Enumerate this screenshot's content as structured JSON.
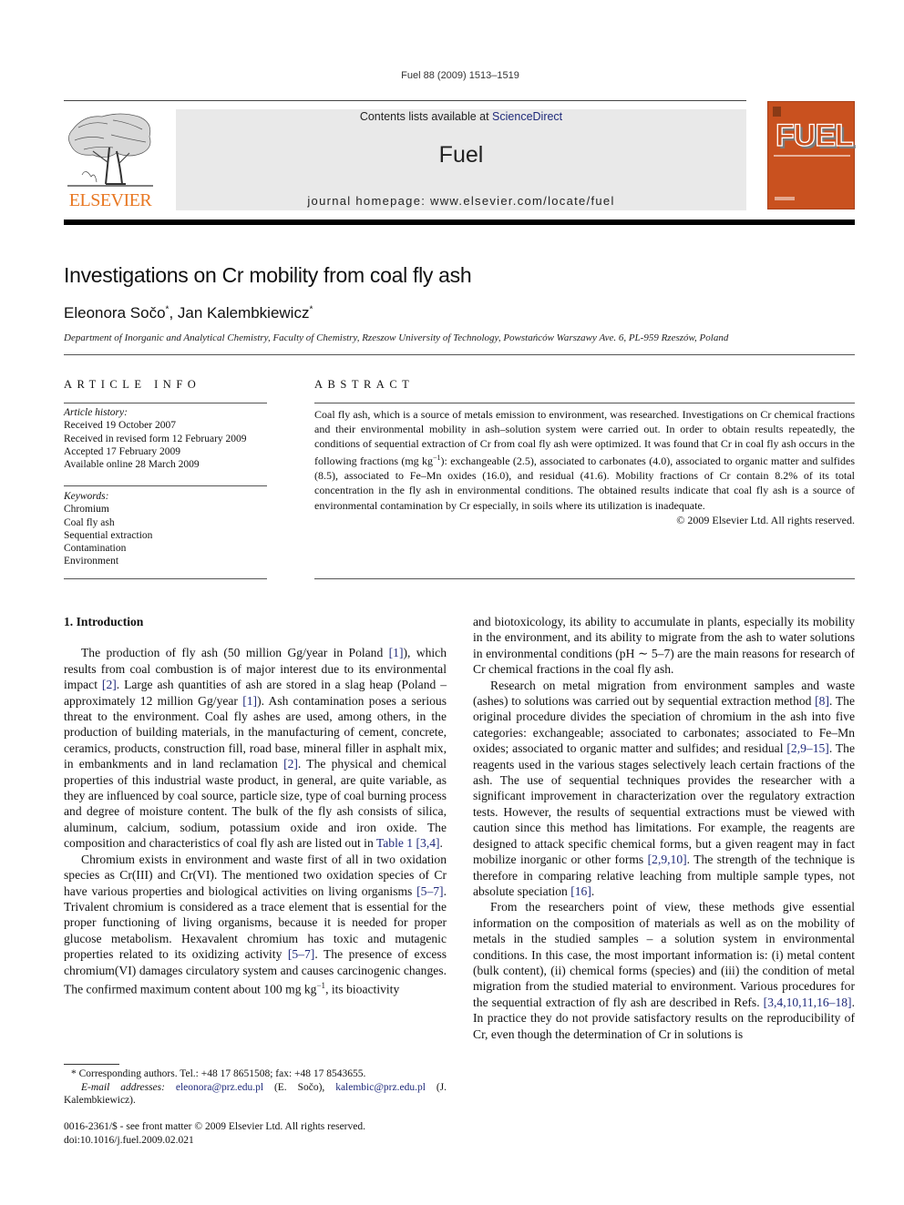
{
  "running_head": "Fuel 88 (2009) 1513–1519",
  "masthead": {
    "contents_prefix": "Contents lists available at ",
    "contents_link": "ScienceDirect",
    "journal_name": "Fuel",
    "homepage": "journal homepage: www.elsevier.com/locate/fuel"
  },
  "publisher_logo": {
    "wordmark": "ELSEVIER",
    "color": "#e87722"
  },
  "cover": {
    "title": "FUEL",
    "color": "#c9511f"
  },
  "article": {
    "title": "Investigations on Cr mobility from coal fly ash",
    "authors": [
      {
        "name": "Eleonora Sočo",
        "mark": "*"
      },
      {
        "name": "Jan Kalembkiewicz",
        "mark": "*"
      }
    ],
    "author_separator": ", ",
    "affiliation": "Department of Inorganic and Analytical Chemistry, Faculty of Chemistry, Rzeszow University of Technology, Powstańców Warszawy Ave. 6, PL-959 Rzeszów, Poland"
  },
  "article_info": {
    "heading": "ARTICLE INFO",
    "history_label": "Article history:",
    "history": [
      "Received 19 October 2007",
      "Received in revised form 12 February 2009",
      "Accepted 17 February 2009",
      "Available online 28 March 2009"
    ],
    "keywords_label": "Keywords:",
    "keywords": [
      "Chromium",
      "Coal fly ash",
      "Sequential extraction",
      "Contamination",
      "Environment"
    ]
  },
  "abstract": {
    "heading": "ABSTRACT",
    "text_1": "Coal fly ash, which is a source of metals emission to environment, was researched. Investigations on Cr chemical fractions and their environmental mobility in ash–solution system were carried out. In order to obtain results repeatedly, the conditions of sequential extraction of Cr from coal fly ash were optimized. It was found that Cr in coal fly ash occurs in the following fractions (mg kg",
    "unit_sup": "−1",
    "text_2": "): exchangeable (2.5), associated to carbonates (4.0), associated to organic matter and sulfides (8.5), associated to Fe–Mn oxides (16.0), and residual (41.6). Mobility fractions of Cr contain 8.2% of its total concentration in the fly ash in environmental conditions. The obtained results indicate that coal fly ash is a source of environmental contamination by Cr especially, in soils where its utilization is inadequate.",
    "copyright": "© 2009 Elsevier Ltd. All rights reserved."
  },
  "body": {
    "section_heading": "1. Introduction",
    "left": {
      "p1": [
        {
          "t": "The production of fly ash (50 million Gg/year in Poland "
        },
        {
          "t": "[1]",
          "ref": true
        },
        {
          "t": "), which results from coal combustion is of major interest due to its environmental impact "
        },
        {
          "t": "[2]",
          "ref": true
        },
        {
          "t": ". Large ash quantities of ash are stored in a slag heap (Poland – approximately 12 million Gg/year "
        },
        {
          "t": "[1]",
          "ref": true
        },
        {
          "t": "). Ash contamination poses a serious threat to the environment. Coal fly ashes are used, among others, in the production of building materials, in the manufacturing of cement, concrete, ceramics, products, construction fill, road base, mineral filler in asphalt mix, in embankments and in land reclamation "
        },
        {
          "t": "[2]",
          "ref": true
        },
        {
          "t": ". The physical and chemical properties of this industrial waste product, in general, are quite variable, as they are influenced by coal source, particle size, type of coal burning process and degree of moisture content. The bulk of the fly ash consists of silica, aluminum, calcium, sodium, potassium oxide and iron oxide. The composition and characteristics of coal fly ash are listed out in "
        },
        {
          "t": "Table 1",
          "ref": true
        },
        {
          "t": " "
        },
        {
          "t": "[3,4]",
          "ref": true
        },
        {
          "t": "."
        }
      ],
      "p2": [
        {
          "t": "Chromium exists in environment and waste first of all in two oxidation species as Cr(III) and Cr(VI). The mentioned two oxidation species of Cr have various properties and biological activities on living organisms "
        },
        {
          "t": "[5–7]",
          "ref": true
        },
        {
          "t": ". Trivalent chromium is considered as a trace element that is essential for the proper functioning of living organisms, because it is needed for proper glucose metabolism. Hexavalent chromium has toxic and mutagenic properties related to its oxidizing activity "
        },
        {
          "t": "[5–7]",
          "ref": true
        },
        {
          "t": ". The presence of excess chromium(VI) damages circulatory system and causes carcinogenic changes. The confirmed maximum content about 100 mg kg"
        },
        {
          "t": "−1",
          "sup": true
        },
        {
          "t": ", its bioactivity"
        }
      ]
    },
    "right": {
      "p1": [
        {
          "t": "and biotoxicology, its ability to accumulate in plants, especially its mobility in the environment, and its ability to migrate from the ash to water solutions in environmental conditions (pH ∼ 5–7) are the main reasons for research of Cr chemical fractions in the coal fly ash."
        }
      ],
      "p2": [
        {
          "t": "Research on metal migration from environment samples and waste (ashes) to solutions was carried out by sequential extraction method "
        },
        {
          "t": "[8]",
          "ref": true
        },
        {
          "t": ". The original procedure divides the speciation of chromium in the ash into five categories: exchangeable; associated to carbonates; associated to Fe–Mn oxides; associated to organic matter and sulfides; and residual "
        },
        {
          "t": "[2,9–15]",
          "ref": true
        },
        {
          "t": ". The reagents used in the various stages selectively leach certain fractions of the ash. The use of sequential techniques provides the researcher with a significant improvement in characterization over the regulatory extraction tests. However, the results of sequential extractions must be viewed with caution since this method has limitations. For example, the reagents are designed to attack specific chemical forms, but a given reagent may in fact mobilize inorganic or other forms "
        },
        {
          "t": "[2,9,10]",
          "ref": true
        },
        {
          "t": ". The strength of the technique is therefore in comparing relative leaching from multiple sample types, not absolute speciation "
        },
        {
          "t": "[16]",
          "ref": true
        },
        {
          "t": "."
        }
      ],
      "p3": [
        {
          "t": "From the researchers point of view, these methods give essential information on the composition of materials as well as on the mobility of metals in the studied samples – a solution system in environmental conditions. In this case, the most important information is: (i) metal content (bulk content), (ii) chemical forms (species) and (iii) the condition of metal migration from the studied material to environment. Various procedures for the sequential extraction of fly ash are described in Refs. "
        },
        {
          "t": "[3,4,10,11,16–18]",
          "ref": true
        },
        {
          "t": ". In practice they do not provide satisfactory results on the reproducibility of Cr, even though the determination of Cr in solutions is"
        }
      ]
    }
  },
  "footnote": {
    "star": "*",
    "corresponding": "Corresponding authors. Tel.: +48 17 8651508; fax: +48 17 8543655.",
    "email_label": "E-mail addresses:",
    "email_1": "eleonora@prz.edu.pl",
    "email_1_owner": " (E. Sočo), ",
    "email_2": "kalembic@prz.edu.pl",
    "email_2_owner": " (J. Kalembkiewicz)."
  },
  "issn_line": "0016-2361/$ - see front matter © 2009 Elsevier Ltd. All rights reserved.",
  "doi": "doi:10.1016/j.fuel.2009.02.021",
  "colors": {
    "link": "#1f2a7a",
    "masthead_bg": "#e9e9e9"
  }
}
